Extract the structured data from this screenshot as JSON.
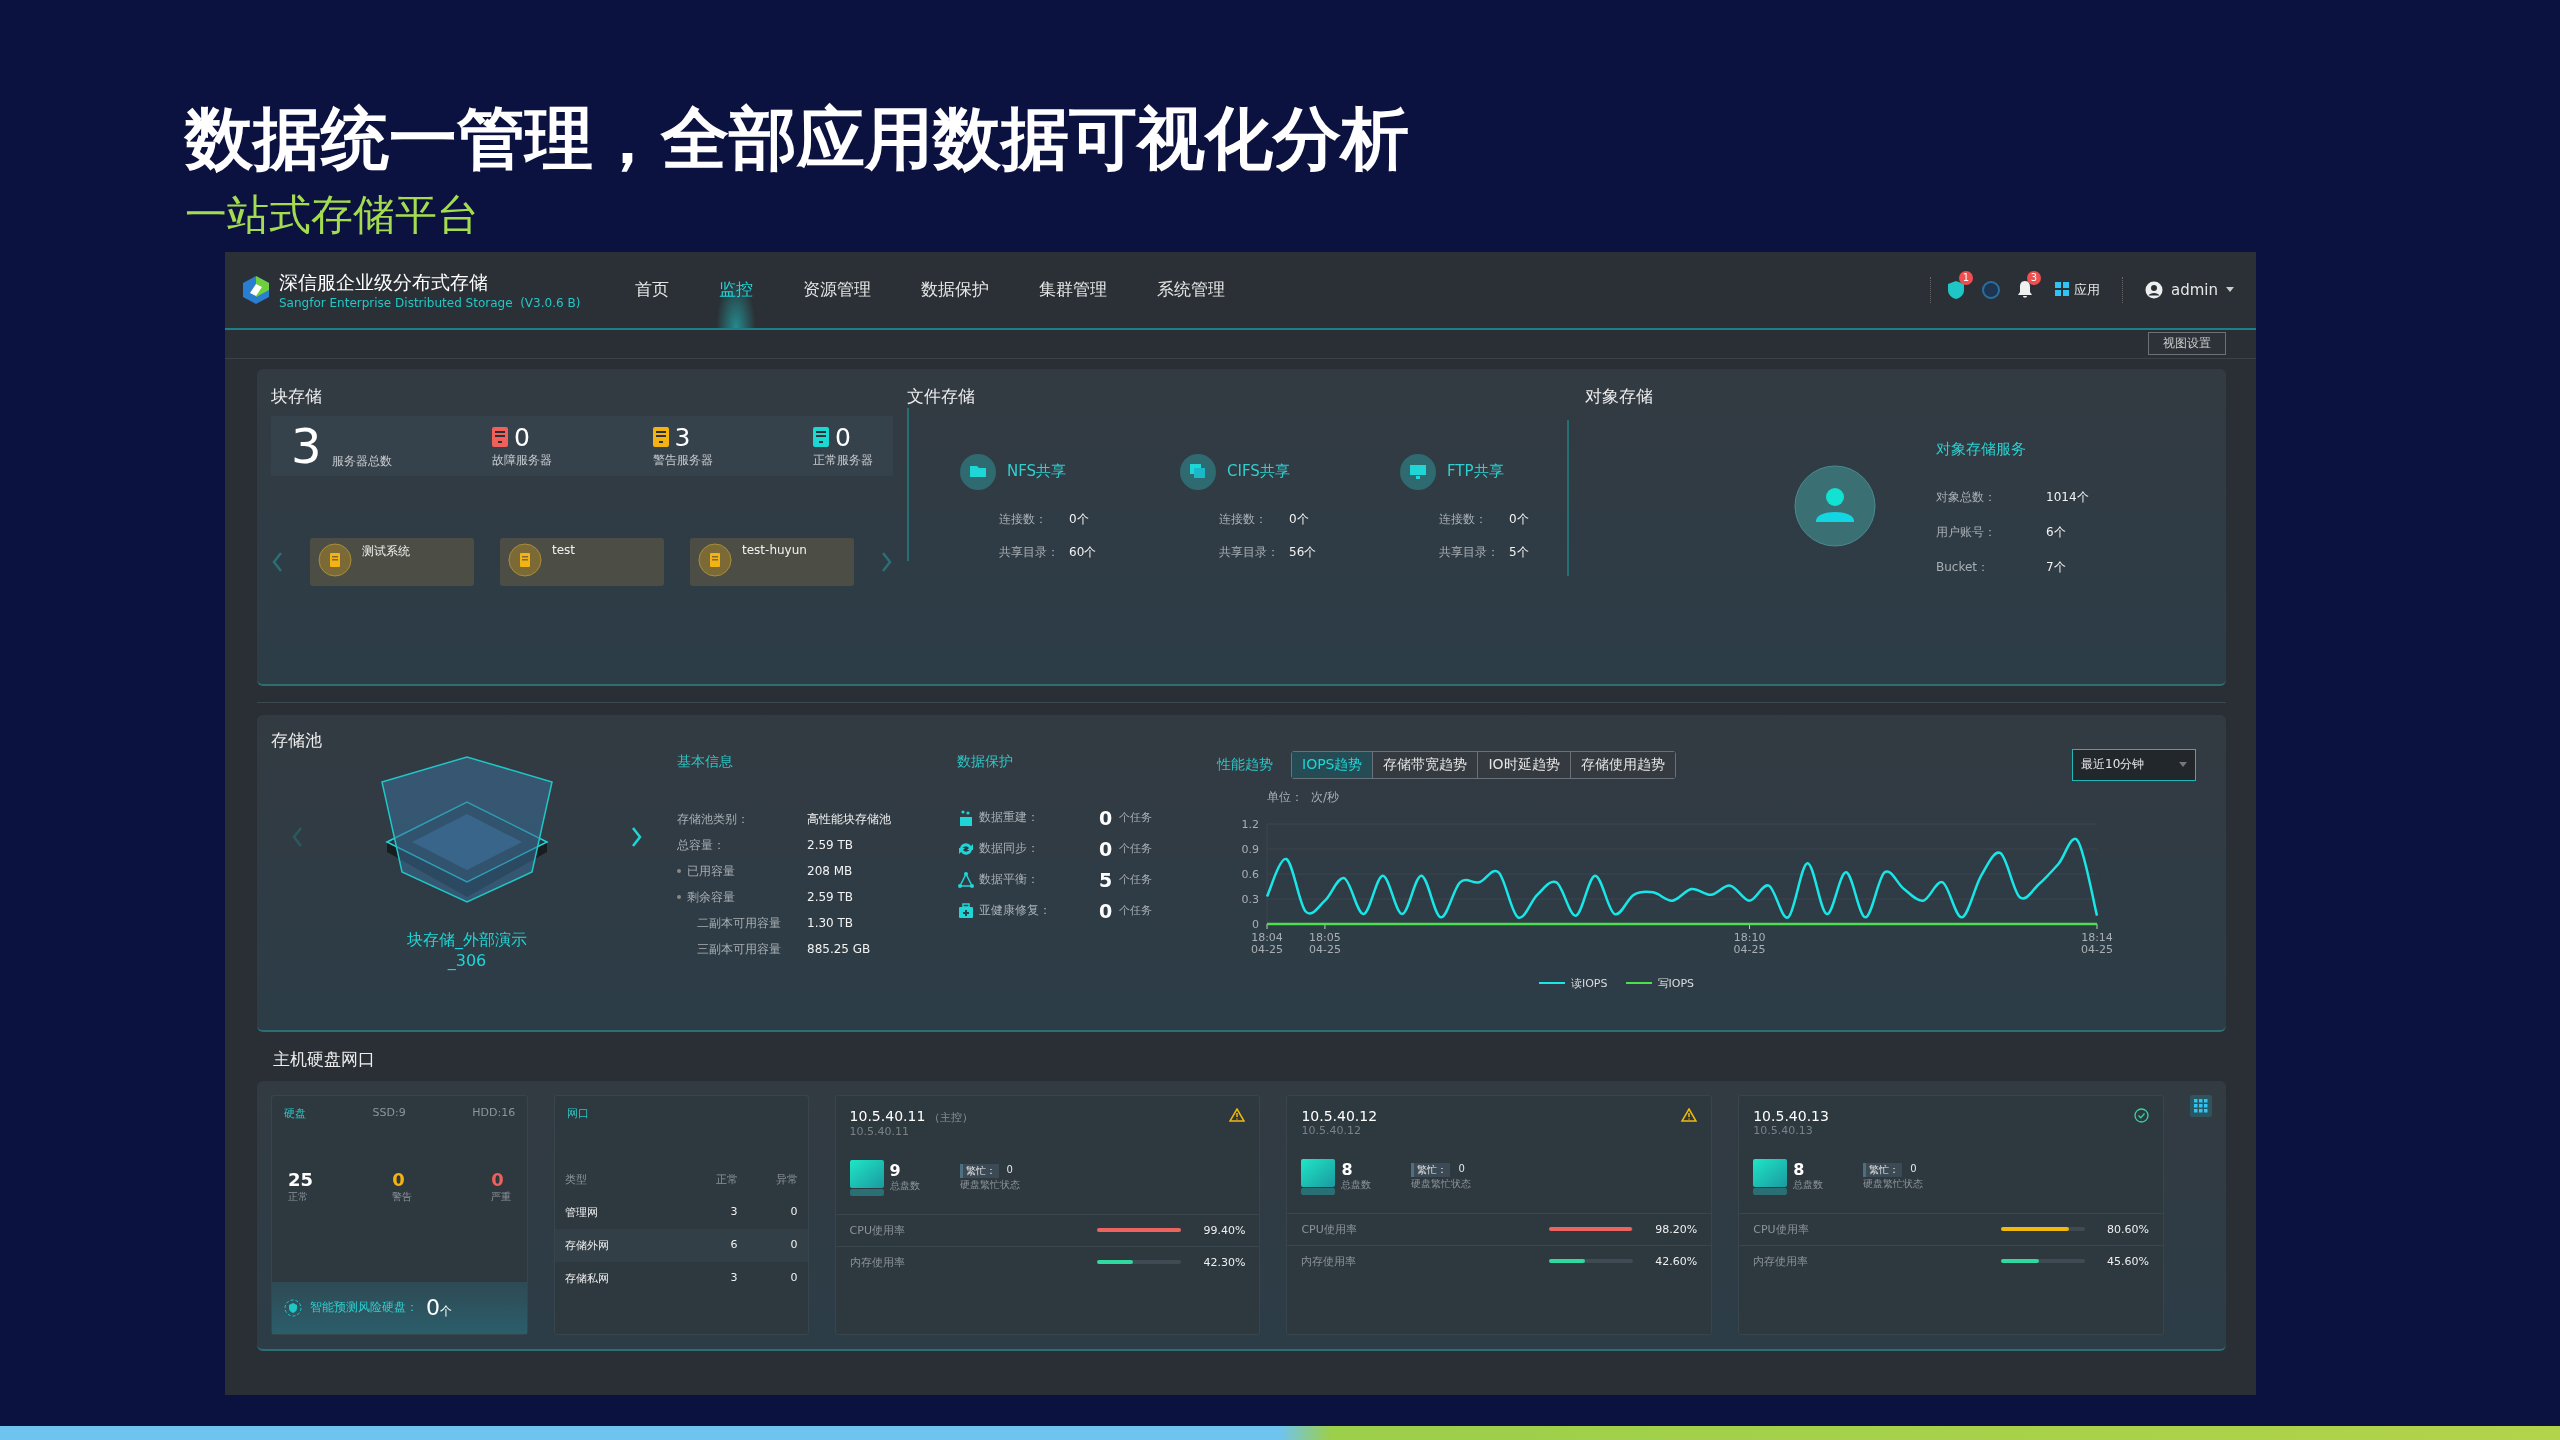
{
  "slide": {
    "title": "数据统一管理，全部应用数据可视化分析",
    "subtitle": "一站式存储平台"
  },
  "app": {
    "brand": {
      "name": "深信服企业级分布式存储",
      "subtitle": "Sangfor Enterprise Distributed Storage  (V3.0.6 B)"
    },
    "nav": [
      {
        "label": "首页",
        "selected": false
      },
      {
        "label": "监控",
        "selected": true
      },
      {
        "label": "资源管理",
        "selected": false
      },
      {
        "label": "数据保护",
        "selected": false
      },
      {
        "label": "集群管理",
        "selected": false
      },
      {
        "label": "系统管理",
        "selected": false
      }
    ],
    "actions": {
      "shield_badge": "1",
      "bell_badge": "3",
      "apps_label": "应用",
      "user": "admin"
    },
    "view_settings": "视图设置",
    "block_storage": {
      "title": "块存储",
      "total": "3",
      "total_label": "服务器总数",
      "stats": [
        {
          "value": "0",
          "label": "故障服务器",
          "color": "#f0605a"
        },
        {
          "value": "3",
          "label": "警告服务器",
          "color": "#f5b312"
        },
        {
          "value": "0",
          "label": "正常服务器",
          "color": "#19d9d2"
        }
      ],
      "systems": [
        "测试系统",
        "test",
        "test-huyun"
      ]
    },
    "file_storage": {
      "title": "文件存储",
      "shares": [
        {
          "name": "NFS共享",
          "kind": "nfs",
          "rows": [
            {
              "label": "连接数：",
              "value": "0个"
            },
            {
              "label": "共享目录：",
              "value": "60个"
            }
          ]
        },
        {
          "name": "CIFS共享",
          "kind": "cifs",
          "rows": [
            {
              "label": "连接数：",
              "value": "0个"
            },
            {
              "label": "共享目录：",
              "value": "56个"
            }
          ]
        },
        {
          "name": "FTP共享",
          "kind": "ftp",
          "rows": [
            {
              "label": "连接数：",
              "value": "0个"
            },
            {
              "label": "共享目录：",
              "value": "5个"
            }
          ]
        }
      ]
    },
    "object_storage": {
      "title": "对象存储",
      "service": "对象存储服务",
      "rows": [
        {
          "label": "对象总数：",
          "value": "1014个"
        },
        {
          "label": "用户账号：",
          "value": "6个"
        },
        {
          "label": "Bucket：",
          "value": "7个"
        }
      ]
    },
    "storage_pool": {
      "title": "存储池",
      "name": "块存储_外部演示_306",
      "basic": {
        "title": "基本信息",
        "rows": [
          {
            "label": "存储池类别：",
            "value": "高性能块存储池",
            "kind": "plain"
          },
          {
            "label": "总容量：",
            "value": "2.59 TB",
            "kind": "plain"
          },
          {
            "label": "已用容量",
            "value": "208 MB",
            "kind": "bullet"
          },
          {
            "label": "剩余容量",
            "value": "2.59 TB",
            "kind": "bullet"
          },
          {
            "label": "二副本可用容量",
            "value": "1.30 TB",
            "kind": "sub"
          },
          {
            "label": "三副本可用容量",
            "value": "885.25 GB",
            "kind": "sub"
          }
        ]
      },
      "protection": {
        "title": "数据保护",
        "rows": [
          {
            "kind": "rebuild",
            "label": "数据重建：",
            "count": "0",
            "unit": "个任务"
          },
          {
            "kind": "sync",
            "label": "数据同步：",
            "count": "0",
            "unit": "个任务"
          },
          {
            "kind": "balance",
            "label": "数据平衡：",
            "count": "5",
            "unit": "个任务"
          },
          {
            "kind": "repair",
            "label": "亚健康修复：",
            "count": "0",
            "unit": "个任务"
          }
        ]
      },
      "trend": {
        "title": "性能趋势",
        "tabs": [
          {
            "label": "IOPS趋势",
            "selected": true
          },
          {
            "label": "存储带宽趋势",
            "selected": false
          },
          {
            "label": "IO时延趋势",
            "selected": false
          },
          {
            "label": "存储使用趋势",
            "selected": false
          }
        ],
        "range": "最近10分钟",
        "unit_label": "单位：",
        "unit": "次/秒",
        "chart_data": {
          "type": "line",
          "categories": [
            "18:04 04-25",
            null,
            null,
            "18:05 04-25",
            null,
            null,
            null,
            null,
            null,
            null,
            null,
            null,
            null,
            null,
            null,
            null,
            null,
            null,
            null,
            null,
            null,
            null,
            null,
            null,
            null,
            "18:10 04-25",
            null,
            null,
            null,
            null,
            null,
            null,
            null,
            null,
            null,
            null,
            null,
            null,
            null,
            null,
            null,
            null,
            null,
            "18:14 04-25"
          ],
          "series": [
            {
              "name": "读IOPS",
              "color": "#19e6e6",
              "values": [
                0.33,
                0.78,
                0.15,
                0.28,
                0.55,
                0.12,
                0.58,
                0.12,
                0.58,
                0.08,
                0.5,
                0.5,
                0.62,
                0.08,
                0.35,
                0.5,
                0.1,
                0.58,
                0.12,
                0.35,
                0.38,
                0.28,
                0.42,
                0.35,
                0.46,
                0.28,
                0.46,
                0.08,
                0.73,
                0.12,
                0.62,
                0.08,
                0.62,
                0.42,
                0.28,
                0.5,
                0.08,
                0.58,
                0.85,
                0.32,
                0.48,
                0.72,
                1.0,
                0.1
              ]
            },
            {
              "name": "写IOPS",
              "color": "#4ce04c",
              "values": [
                0,
                0,
                0,
                0,
                0,
                0,
                0,
                0,
                0,
                0,
                0,
                0,
                0,
                0,
                0,
                0,
                0,
                0,
                0,
                0,
                0,
                0,
                0,
                0,
                0,
                0,
                0,
                0,
                0,
                0,
                0,
                0,
                0,
                0,
                0,
                0,
                0,
                0,
                0,
                0,
                0,
                0,
                0,
                0
              ]
            }
          ],
          "ylim": [
            0,
            1.2
          ],
          "yticks": [
            0,
            0.3,
            0.6,
            0.9,
            1.2
          ]
        }
      }
    },
    "hosts": {
      "title": "主机硬盘网口",
      "disks": {
        "title": "硬盘",
        "ssd": "SSD:9",
        "hdd": "HDD:16",
        "counts": [
          {
            "value": "25",
            "label": "正常",
            "color": "#ffffff"
          },
          {
            "value": "0",
            "label": "警告",
            "color": "#f5b312"
          },
          {
            "value": "0",
            "label": "严重",
            "color": "#f0605a"
          }
        ],
        "risk_label": "智能预测风险硬盘：",
        "risk_value": "0",
        "risk_unit": "个"
      },
      "ports": {
        "title": "网口",
        "columns": [
          "类型",
          "正常",
          "异常"
        ],
        "rows": [
          [
            "管理网",
            "3",
            "0"
          ],
          [
            "存储外网",
            "6",
            "0"
          ],
          [
            "存储私网",
            "3",
            "0"
          ]
        ]
      },
      "nodes": [
        {
          "ip": "10.5.40.11",
          "role": "（主控）",
          "sub": "10.5.40.11",
          "kind": "warning",
          "disks": "9",
          "disks_label": "总盘数",
          "busy_label": "繁忙：",
          "busy": "0",
          "busy_caption": "硬盘繁忙状态",
          "cpu_label": "CPU使用率",
          "cpu": {
            "level": 0.994
          },
          "cpu_text": "99.40%",
          "mem_label": "内存使用率",
          "mem": {
            "level": 0.423
          },
          "mem_text": "42.30%"
        },
        {
          "ip": "10.5.40.12",
          "sub": "10.5.40.12",
          "kind": "warning",
          "disks": "8",
          "disks_label": "总盘数",
          "busy_label": "繁忙：",
          "busy": "0",
          "busy_caption": "硬盘繁忙状态",
          "cpu_label": "CPU使用率",
          "cpu": {
            "level": 0.982
          },
          "cpu_text": "98.20%",
          "mem_label": "内存使用率",
          "mem": {
            "level": 0.426
          },
          "mem_text": "42.60%"
        },
        {
          "ip": "10.5.40.13",
          "sub": "10.5.40.13",
          "kind": "ok",
          "disks": "8",
          "disks_label": "总盘数",
          "busy_label": "繁忙：",
          "busy": "0",
          "busy_caption": "硬盘繁忙状态",
          "cpu_label": "CPU使用率",
          "cpu": {
            "level": 0.806
          },
          "cpu_text": "80.60%",
          "mem_label": "内存使用率",
          "mem": {
            "level": 0.456
          },
          "mem_text": "45.60%"
        }
      ]
    }
  }
}
